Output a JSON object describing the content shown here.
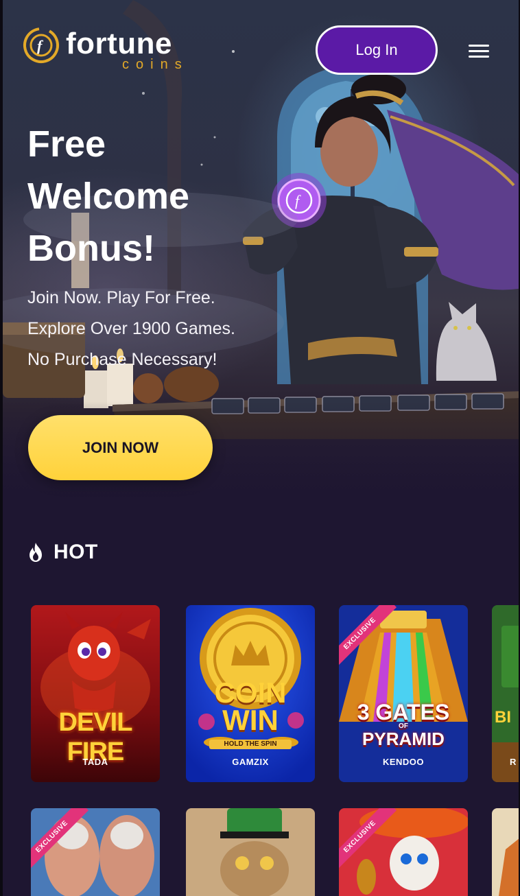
{
  "header": {
    "logo_word": "fortune",
    "logo_sub": "coins",
    "login_label": "Log In"
  },
  "hero": {
    "title_line1": "Free",
    "title_line2": "Welcome",
    "title_line3": "Bonus!",
    "sub_line1": "Join Now. Play For Free.",
    "sub_line2": "Explore Over 1900 Games.",
    "sub_line3": "No Purchase Necessary!",
    "join_label": "JOIN NOW"
  },
  "hot": {
    "title": "HOT",
    "cards": [
      {
        "game": "DEVIL FIRE",
        "provider": "TADA",
        "exclusive": false
      },
      {
        "game_line1": "COIN",
        "game_line2": "WIN",
        "game_tag": "HOLD THE SPIN",
        "provider": "GAMZIX",
        "exclusive": false
      },
      {
        "game_line1": "3 GATES",
        "game_small": "OF",
        "game_line2": "PYRAMID",
        "provider": "KENDOO",
        "exclusive": true,
        "ribbon": "EXCLUSIVE"
      },
      {
        "game_partial": "BI",
        "provider_partial": "R",
        "exclusive": false
      }
    ],
    "row2": [
      {
        "exclusive": true,
        "ribbon": "EXCLUSIVE"
      },
      {
        "exclusive": false
      },
      {
        "exclusive": true,
        "ribbon": "EXCLUSIVE"
      },
      {
        "exclusive": false
      }
    ]
  },
  "colors": {
    "background": "#1e1631",
    "login_button": "#5b1aa6",
    "join_button": "#ffd23a",
    "logo_gold": "#e3a928",
    "exclusive_ribbon": "#e2337a"
  },
  "icons": [
    "fortune-coin-logo-icon",
    "hamburger-menu-icon",
    "fire-icon"
  ]
}
